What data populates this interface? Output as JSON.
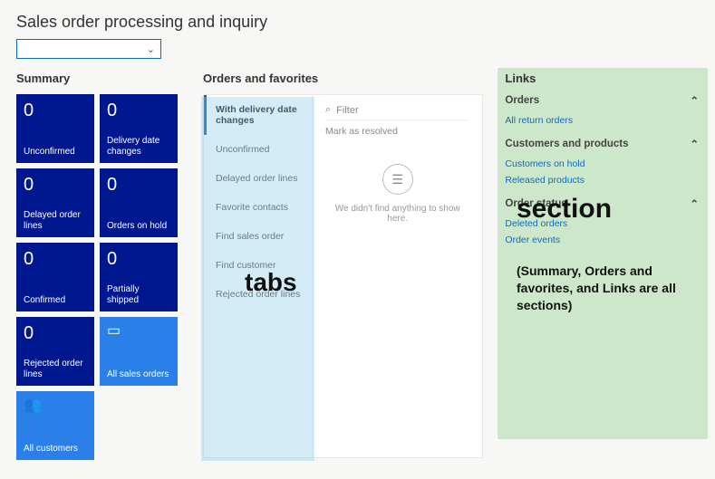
{
  "title": "Sales order processing and inquiry",
  "dropdown_placeholder": "",
  "summary": {
    "heading": "Summary",
    "tiles": [
      {
        "count": "0",
        "label": "Unconfirmed"
      },
      {
        "count": "0",
        "label": "Delivery date changes"
      },
      {
        "count": "0",
        "label": "Delayed order lines"
      },
      {
        "count": "0",
        "label": "Orders on hold"
      },
      {
        "count": "0",
        "label": "Confirmed"
      },
      {
        "count": "0",
        "label": "Partially shipped"
      },
      {
        "count": "0",
        "label": "Rejected order lines"
      },
      {
        "count": "",
        "label": "All sales orders",
        "icon": "▭",
        "light": true
      },
      {
        "count": "",
        "label": "All customers",
        "icon": "👥",
        "light": true
      }
    ]
  },
  "orders": {
    "heading": "Orders and favorites",
    "tabs": [
      "With delivery date changes",
      "Unconfirmed",
      "Delayed order lines",
      "Favorite contacts",
      "Find sales order",
      "Find customer",
      "Rejected order lines"
    ],
    "filter_placeholder": "Filter",
    "mark_resolved": "Mark as resolved",
    "empty_text": "We didn't find anything to show here."
  },
  "links": {
    "heading": "Links",
    "groups": [
      {
        "title": "Orders",
        "items": [
          "All return orders"
        ]
      },
      {
        "title": "Customers and products",
        "items": [
          "Customers on hold",
          "Released products"
        ]
      },
      {
        "title": "Order status",
        "items": [
          "Deleted orders",
          "Order events"
        ]
      }
    ]
  },
  "annotations": {
    "tabs": "tabs",
    "section": "section",
    "sub": "(Summary, Orders and favorites, and Links are all sections)"
  }
}
